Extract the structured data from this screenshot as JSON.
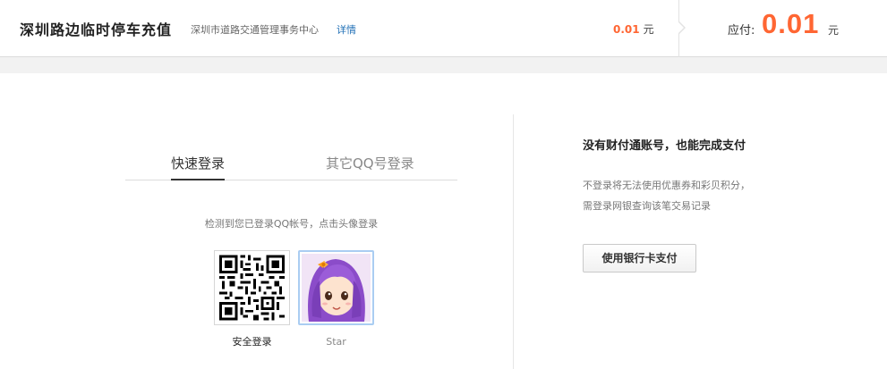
{
  "header": {
    "title": "深圳路边临时停车充值",
    "merchant": "深圳市道路交通管理事务中心",
    "detail_link": "详情",
    "amount_value": "0.01",
    "amount_unit": "元",
    "pay_label": "应付:",
    "pay_amount": "0.01",
    "pay_unit": "元"
  },
  "login": {
    "tabs": [
      {
        "label": "快速登录",
        "active": true
      },
      {
        "label": "其它QQ号登录",
        "active": false
      }
    ],
    "hint": "检测到您已登录QQ帐号，点击头像登录",
    "qr_caption": "安全登录",
    "avatar_caption": "Star"
  },
  "alt_pay": {
    "title": "没有财付通账号，也能完成支付",
    "desc_line1": "不登录将无法使用优惠券和彩贝积分，",
    "desc_line2": "需登录网银查询该笔交易记录",
    "button_label": "使用银行卡支付"
  },
  "colors": {
    "accent": "#ff6633",
    "link": "#1f6fb6",
    "avatar_border": "#aacdf2",
    "avatar_hair": "#8b4cc9"
  },
  "icons": {
    "qr": "qr-code-icon",
    "avatar": "user-avatar-icon"
  }
}
